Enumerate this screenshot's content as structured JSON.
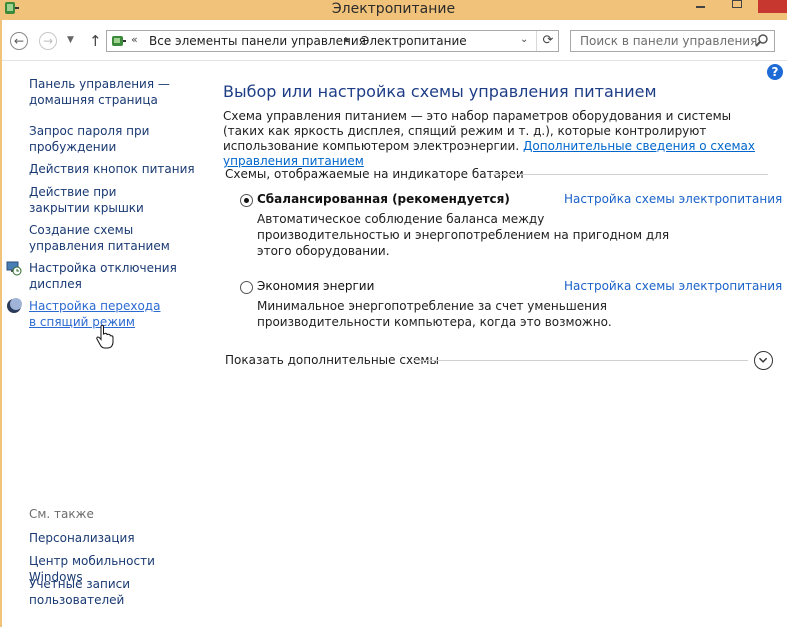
{
  "window": {
    "title": "Электропитание"
  },
  "address": {
    "chevron": "«",
    "crumbs": [
      "Все элементы панели управления",
      "Электропитание"
    ],
    "separator": "▸"
  },
  "search": {
    "placeholder": "Поиск в панели управления"
  },
  "sidebar": {
    "items": [
      {
        "label": "Панель управления — домашняя страница"
      },
      {
        "label": "Запрос пароля при пробуждении"
      },
      {
        "label": "Действия кнопок питания"
      },
      {
        "label": "Действие при закрытии крышки"
      },
      {
        "label": "Создание схемы управления питанием"
      },
      {
        "label": "Настройка отключения дисплея"
      },
      {
        "label": "Настройка перехода в спящий режим"
      }
    ],
    "see_also_title": "См. также",
    "see_also": [
      {
        "label": "Персонализация"
      },
      {
        "label": "Центр мобильности Windows"
      },
      {
        "label": "Учетные записи пользователей"
      }
    ]
  },
  "main": {
    "title": "Выбор или настройка схемы управления питанием",
    "description": "Схема управления питанием — это набор параметров оборудования и системы (таких как яркость дисплея, спящий режим и т. д.), которые контролируют использование компьютером электроэнергии.",
    "more_info_link": "Дополнительные сведения о схемах управления питанием",
    "plans_section_label": "Схемы, отображаемые на индикаторе батареи",
    "plans": [
      {
        "name": "Сбалансированная (рекомендуется)",
        "selected": true,
        "settings_link": "Настройка схемы электропитания",
        "description": "Автоматическое соблюдение баланса между производительностью и энергопотреблением на пригодном для этого оборудовании."
      },
      {
        "name": "Экономия энергии",
        "selected": false,
        "settings_link": "Настройка схемы электропитания",
        "description": "Минимальное энергопотребление за счет уменьшения производительности компьютера, когда это возможно."
      }
    ],
    "show_more_label": "Показать дополнительные схемы"
  },
  "colors": {
    "titlebar": "#f0c27a",
    "close_button": "#c7372f",
    "heading": "#1e3d87",
    "link": "#1a62c9"
  },
  "icons": {
    "app": "power-options-icon",
    "back": "back-arrow-icon",
    "forward": "forward-arrow-icon",
    "up": "up-arrow-icon",
    "refresh": "refresh-icon",
    "search": "search-icon",
    "help": "help-icon",
    "display": "display-timer-icon",
    "sleep": "moon-icon",
    "expand": "chevron-down-icon"
  }
}
